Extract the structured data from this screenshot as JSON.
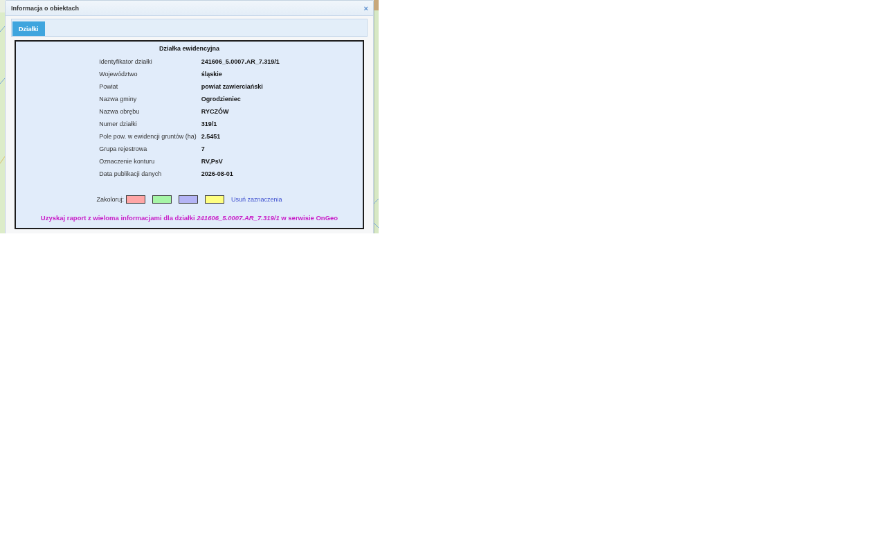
{
  "dialog": {
    "title": "Informacja o obiektach",
    "close": "×",
    "tabs": [
      {
        "label": "Działki",
        "selected": true
      }
    ],
    "parcel": {
      "heading": "Działka ewidencyjna",
      "rows": [
        {
          "label": "Identyfikator działki",
          "value": "241606_5.0007.AR_7.319/1"
        },
        {
          "label": "Województwo",
          "value": "śląskie"
        },
        {
          "label": "Powiat",
          "value": "powiat zawierciański"
        },
        {
          "label": "Nazwa gminy",
          "value": "Ogrodzieniec"
        },
        {
          "label": "Nazwa obrębu",
          "value": "RYCZÓW"
        },
        {
          "label": "Numer działki",
          "value": "319/1"
        },
        {
          "label": "Pole pow. w ewidencji gruntów (ha)",
          "value": "2.5451"
        },
        {
          "label": "Grupa rejestrowa",
          "value": "7"
        },
        {
          "label": "Oznaczenie konturu",
          "value": "RV,PsV"
        },
        {
          "label": "Data publikacji danych",
          "value": "2026-08-01"
        }
      ],
      "coloring": {
        "label": "Zakoloruj:",
        "swatches": [
          {
            "color": "#ffa6a6"
          },
          {
            "color": "#a6f5a6"
          },
          {
            "color": "#b4b4f5"
          },
          {
            "color": "#ffff80"
          }
        ],
        "clear_link": "Usuń zaznaczenia"
      },
      "report_link": "Uzyskaj raport z wieloma informacjami dla działki *241606_5.0007.AR_7.319/1* w serwisie OnGeo"
    }
  }
}
